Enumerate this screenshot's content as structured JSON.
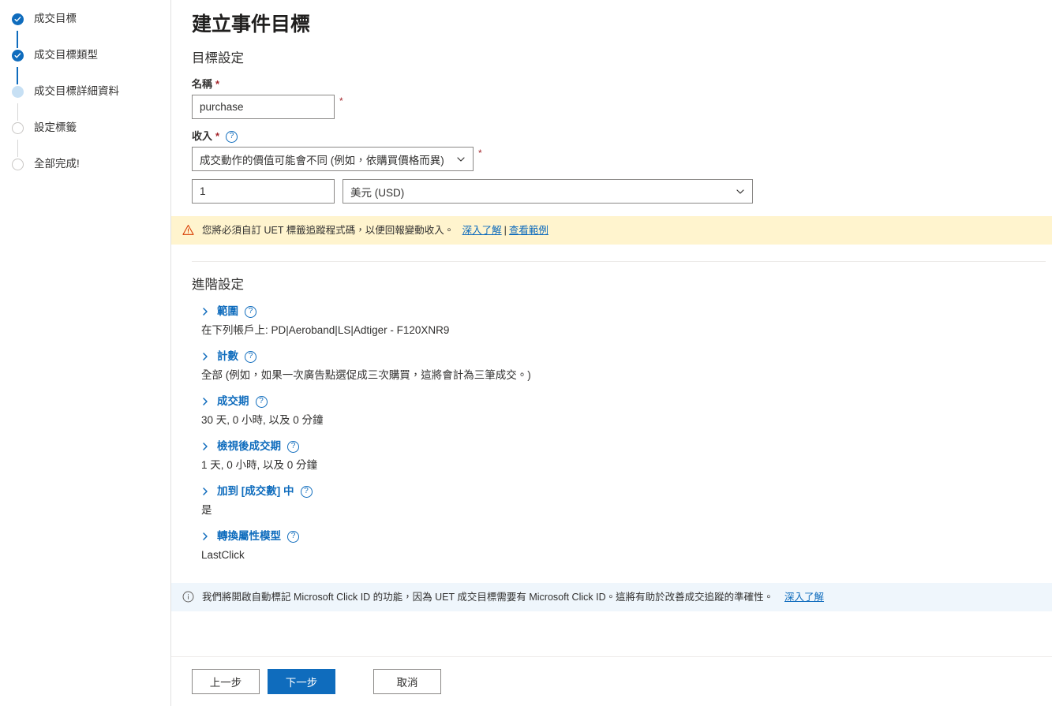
{
  "stepper": {
    "steps": [
      {
        "label": "成交目標",
        "state": "done"
      },
      {
        "label": "成交目標類型",
        "state": "done"
      },
      {
        "label": "成交目標詳細資料",
        "state": "current"
      },
      {
        "label": "設定標籤",
        "state": "todo"
      },
      {
        "label": "全部完成!",
        "state": "todo"
      }
    ]
  },
  "header": {
    "title": "建立事件目標"
  },
  "goal_settings": {
    "section_title": "目標設定",
    "name_label": "名稱",
    "name_required_mark": "*",
    "name_value": "purchase",
    "name_trailing_star": "*",
    "revenue_label": "收入",
    "revenue_required_mark": "*",
    "revenue_help_icon": "question-circle-icon",
    "revenue_selected": "成交動作的價值可能會不同 (例如，依購買價格而異)",
    "revenue_trailing_star": "*",
    "amount_value": "1",
    "currency_selected": "美元 (USD)"
  },
  "warning_banner": {
    "icon": "warning-triangle-icon",
    "text": "您將必須自訂 UET 標籤追蹤程式碼，以便回報變動收入。",
    "link_primary": "深入了解",
    "separator": "|",
    "link_secondary": "查看範例",
    "background_color": "#FFF4CE"
  },
  "advanced": {
    "title": "進階設定",
    "items": [
      {
        "label": "範圍",
        "value": "在下列帳戶上: PD|Aeroband|LS|Adtiger - F120XNR9",
        "icon": "chevron-right-icon",
        "help_icon": "question-circle-icon"
      },
      {
        "label": "計數",
        "value": "全部 (例如，如果一次廣告點選促成三次購買，這將會計為三筆成交。)",
        "icon": "chevron-right-icon",
        "help_icon": "question-circle-icon"
      },
      {
        "label": "成交期",
        "value": "30 天, 0 小時, 以及 0 分鐘",
        "icon": "chevron-right-icon",
        "help_icon": "question-circle-icon"
      },
      {
        "label": "檢視後成交期",
        "value": "1 天, 0 小時, 以及 0 分鐘",
        "icon": "chevron-right-icon",
        "help_icon": "question-circle-icon"
      },
      {
        "label": "加到 [成交數] 中",
        "value": "是",
        "icon": "chevron-right-icon",
        "help_icon": "question-circle-icon"
      },
      {
        "label": "轉換屬性模型",
        "value": "LastClick",
        "icon": "chevron-right-icon",
        "help_icon": "question-circle-icon"
      }
    ]
  },
  "info_banner": {
    "icon": "info-circle-icon",
    "text": "我們將開啟自動標記 Microsoft Click ID 的功能，因為 UET 成交目標需要有 Microsoft Click ID。這將有助於改善成交追蹤的準確性。",
    "link": "深入了解",
    "background_color": "#EFF6FC"
  },
  "footer": {
    "back_label": "上一步",
    "next_label": "下一步",
    "cancel_label": "取消",
    "primary_color": "#0F6CBD"
  }
}
